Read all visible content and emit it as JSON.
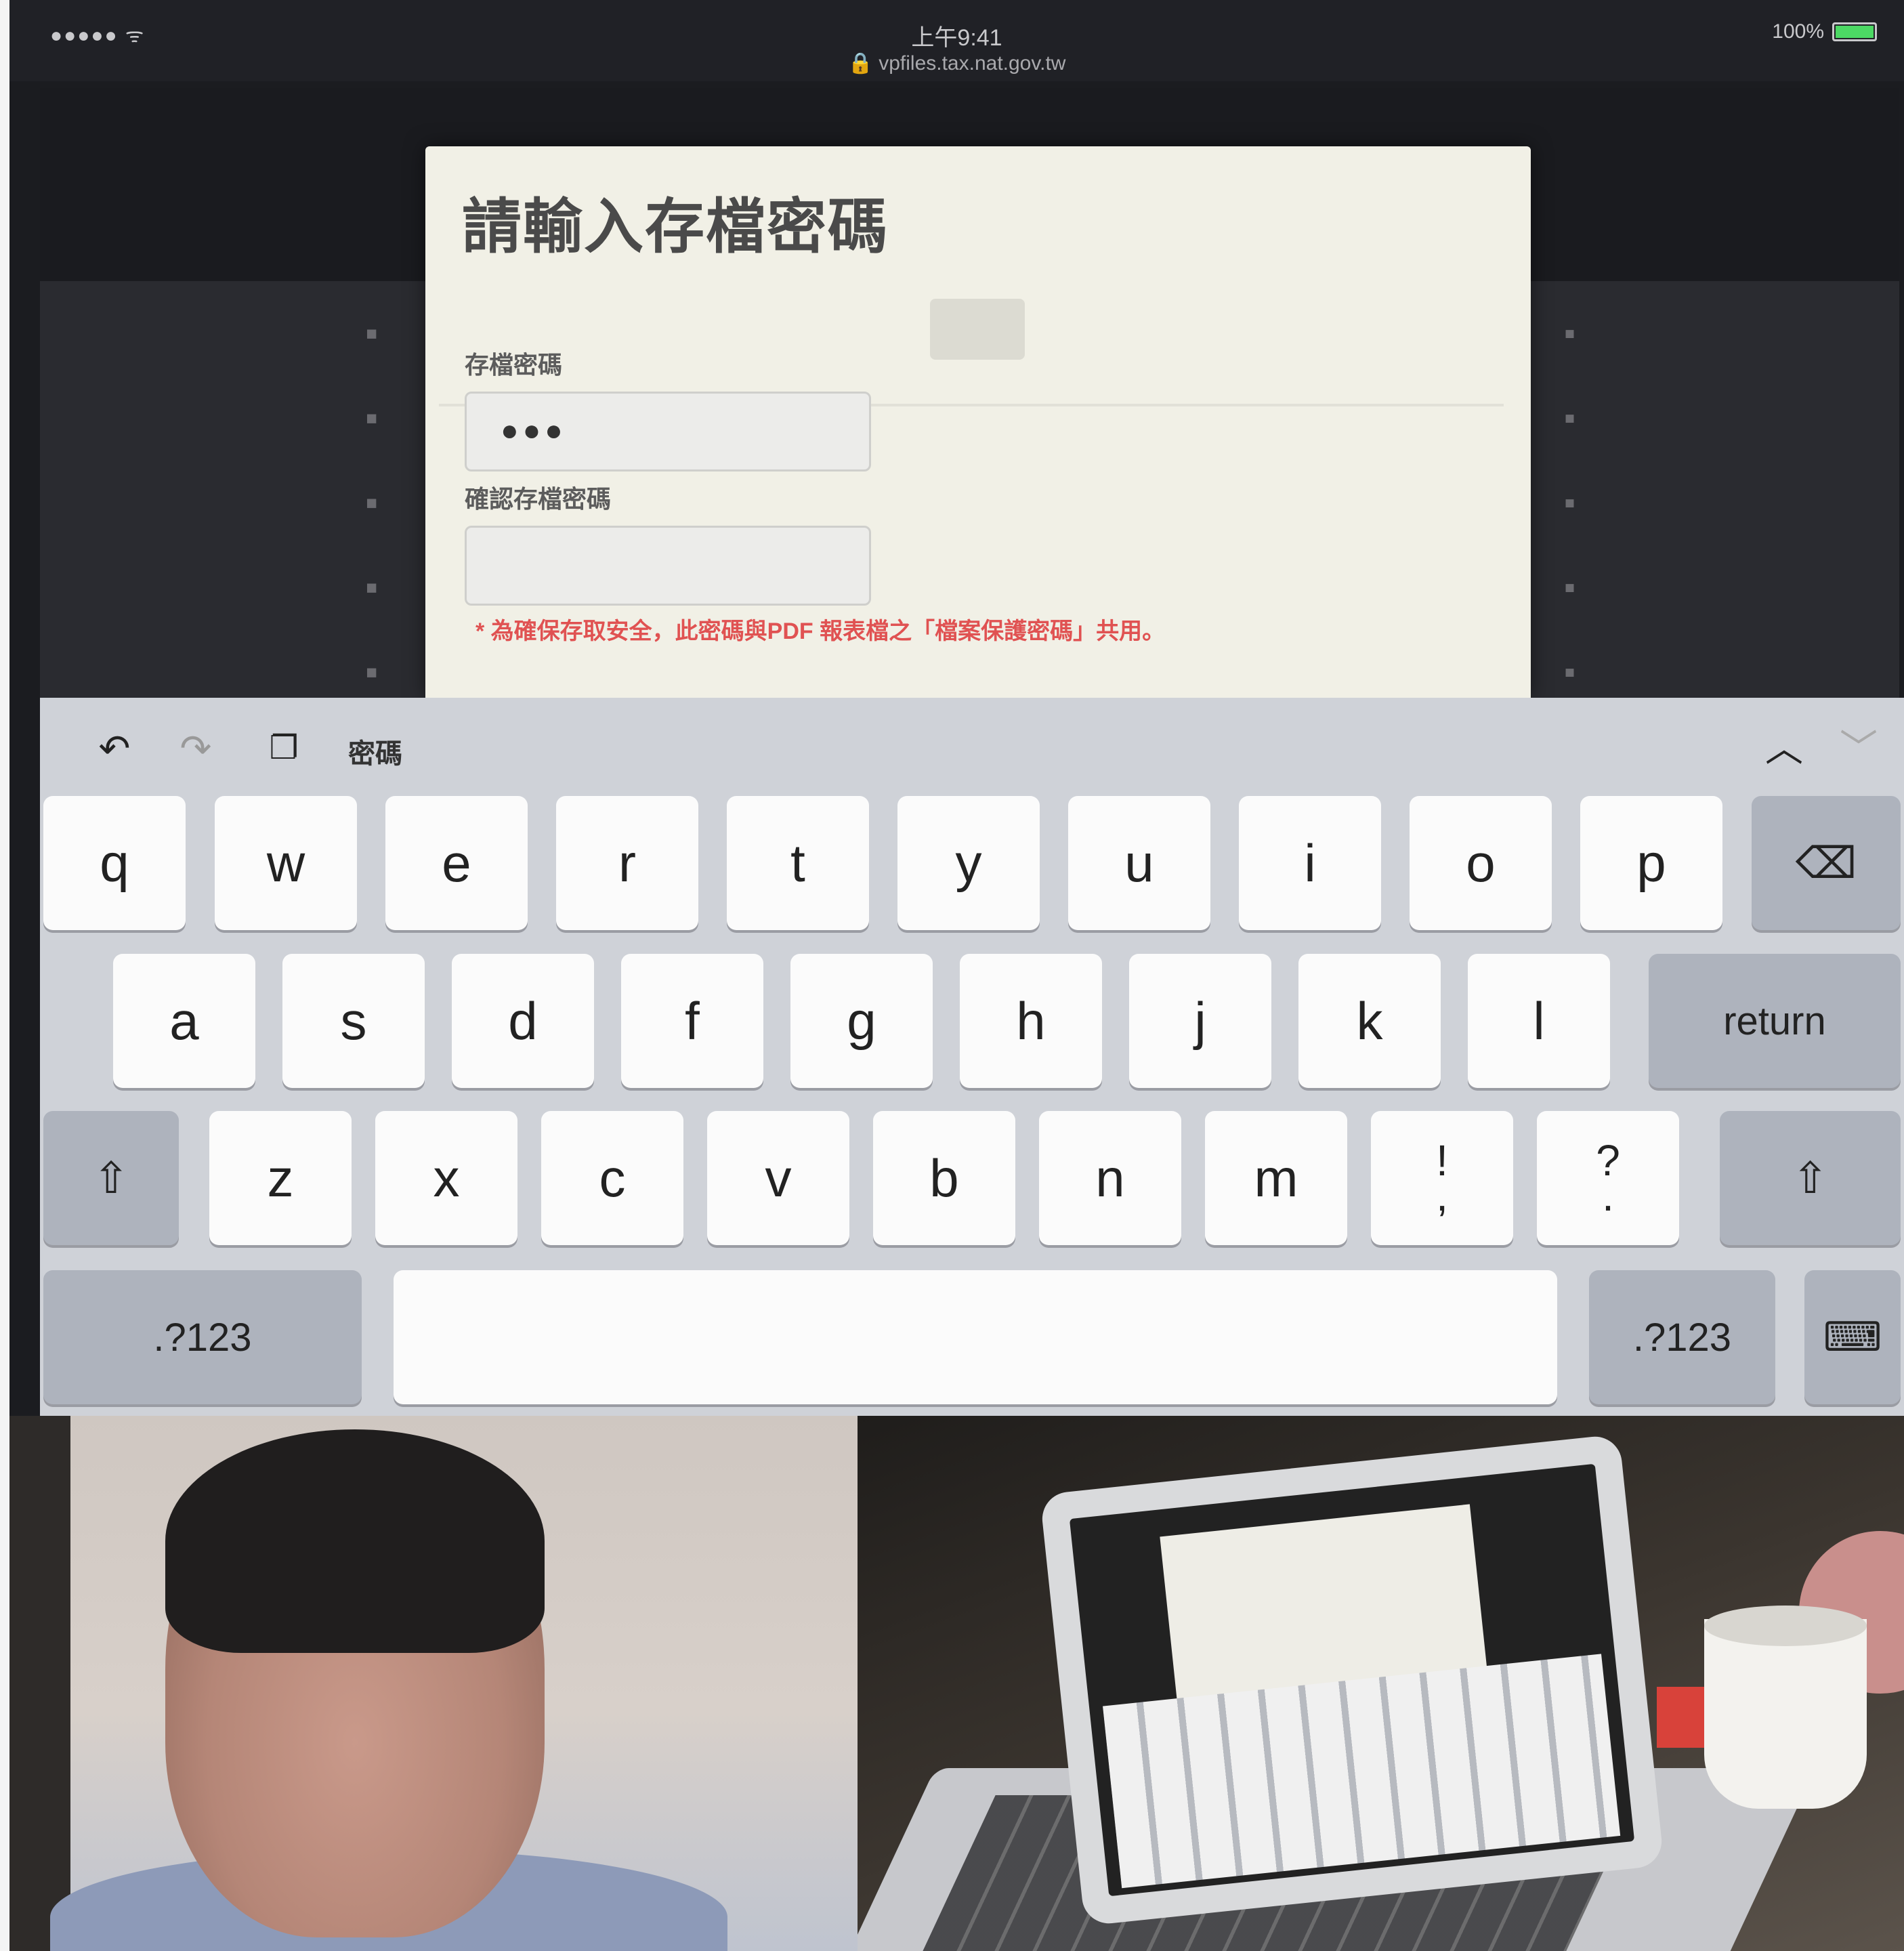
{
  "status_bar": {
    "signal": "●●●●● ᯤ",
    "time": "上午9:41",
    "url": "🔒 vpfiles.tax.nat.gov.tw",
    "battery": "100%"
  },
  "modal": {
    "title": "請輸入存檔密碼",
    "password_label": "存檔密碼",
    "password_value": "●●●",
    "confirm_label": "確認存檔密碼",
    "confirm_value": "",
    "note": "* 為確保存取安全，此密碼與PDF 報表檔之「檔案保護密碼」共用。"
  },
  "keyboard": {
    "toolbar_label": "密碼",
    "row1": [
      "q",
      "w",
      "e",
      "r",
      "t",
      "y",
      "u",
      "i",
      "o",
      "p"
    ],
    "row2": [
      "a",
      "s",
      "d",
      "f",
      "g",
      "h",
      "j",
      "k",
      "l"
    ],
    "row3": [
      "z",
      "x",
      "c",
      "v",
      "b",
      "n",
      "m"
    ],
    "punct1_top": "!",
    "punct1_bottom": ",",
    "punct2_top": "?",
    "punct2_bottom": ".",
    "return_label": "return",
    "numbers_left": ".?123",
    "numbers_right": ".?123",
    "space_label": ""
  },
  "icons": {
    "undo": "undo-icon",
    "redo": "redo-icon",
    "paste": "paste-icon",
    "chevron_up": "chevron-up-icon",
    "chevron_down": "chevron-down-icon",
    "backspace": "backspace-icon",
    "shift": "shift-icon",
    "dismiss_keyboard": "keyboard-dismiss-icon"
  }
}
